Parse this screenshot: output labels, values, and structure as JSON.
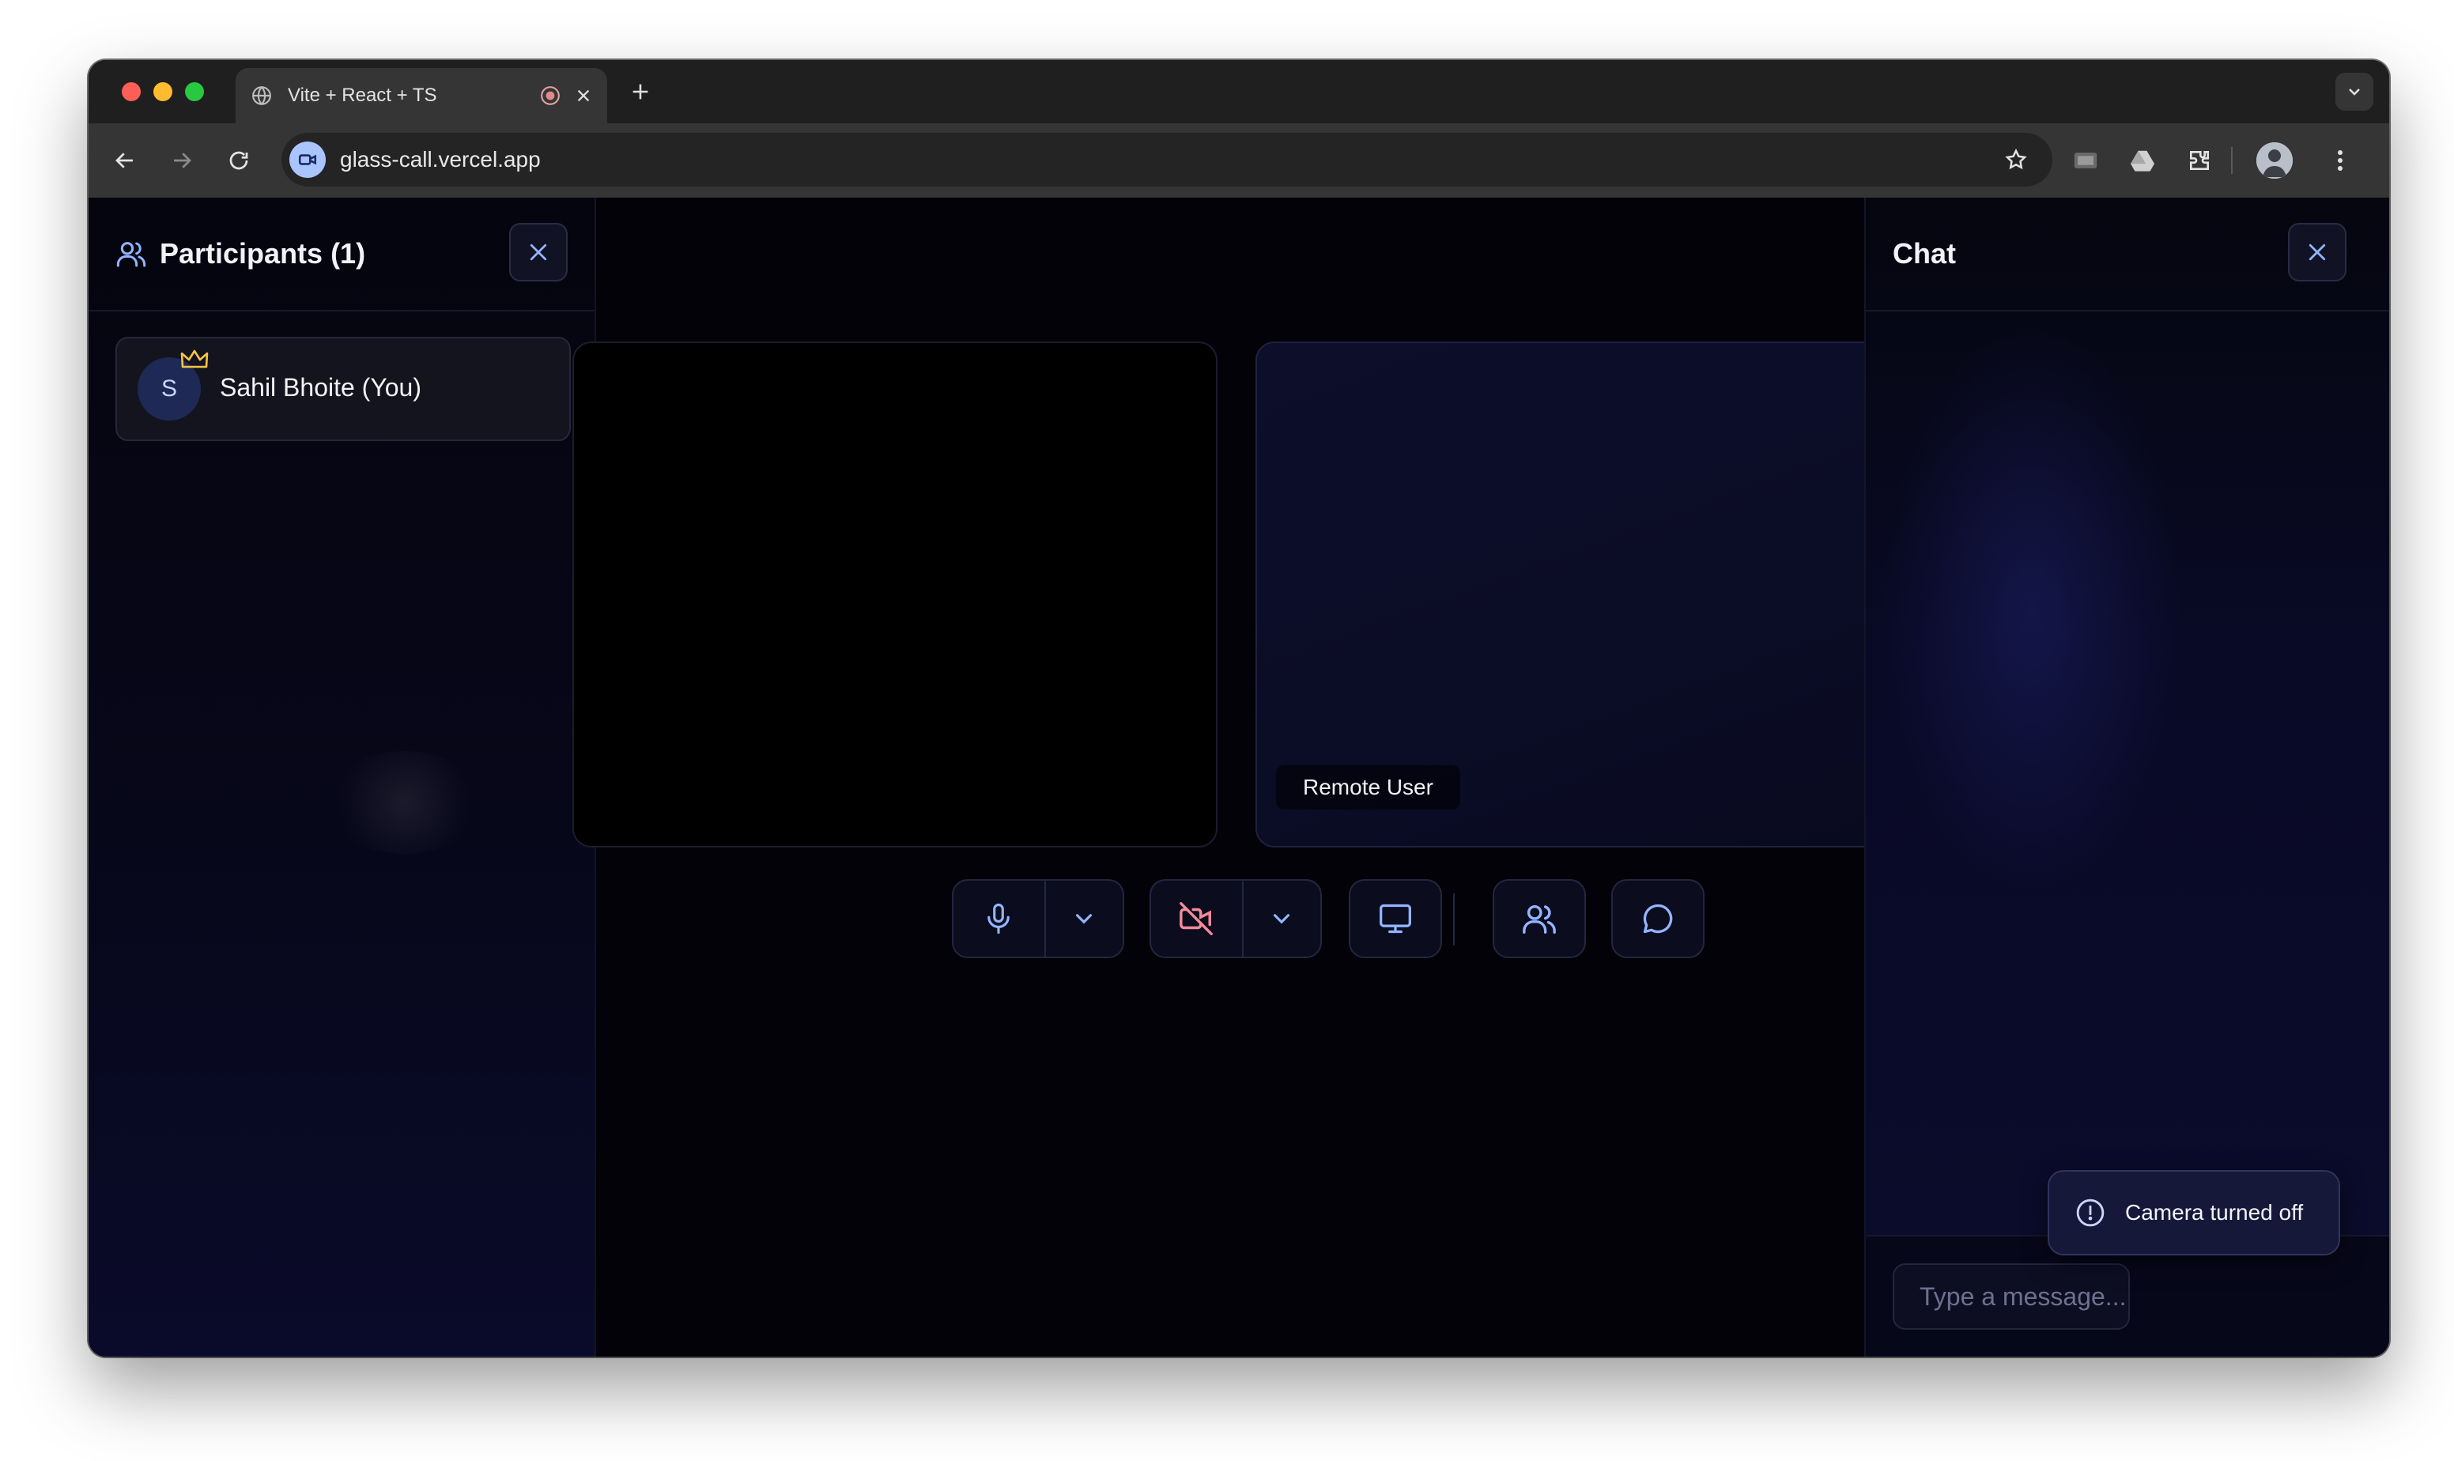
{
  "browser": {
    "tab_title": "Vite + React + TS",
    "url": "glass-call.vercel.app"
  },
  "participants_panel": {
    "title": "Participants (1)",
    "participants": [
      {
        "initial": "S",
        "name": "Sahil Bhoite (You)",
        "is_host": true
      }
    ]
  },
  "video": {
    "remote_label": "Remote User"
  },
  "controls": {
    "mic": "on",
    "camera": "off"
  },
  "chat_panel": {
    "title": "Chat",
    "input_placeholder": "Type a message..."
  },
  "toast": {
    "message": "Camera turned off"
  },
  "colors": {
    "accent_icon": "#93b4ff",
    "camera_off": "#f28b9b",
    "crown": "#f5c542",
    "background": "#020208"
  }
}
